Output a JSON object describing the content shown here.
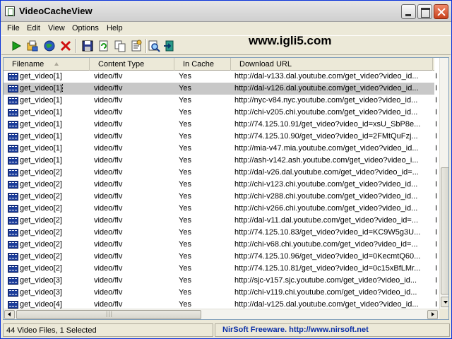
{
  "window": {
    "title": "VideoCacheView"
  },
  "menu": [
    "File",
    "Edit",
    "View",
    "Options",
    "Help"
  ],
  "watermark": "www.igli5.com",
  "toolbar": {
    "icons": [
      "play-icon",
      "export-icon",
      "globe-icon",
      "delete-icon",
      "save-icon",
      "refresh-icon",
      "copy-icon",
      "properties-icon",
      "find-icon",
      "exit-icon"
    ]
  },
  "columns": [
    "Filename",
    "Content Type",
    "In Cache",
    "Download URL"
  ],
  "rows": [
    {
      "file": "get_video[1]",
      "type": "video/flv",
      "cache": "Yes",
      "url": "http://dal-v133.dal.youtube.com/get_video?video_id...",
      "extra": "I",
      "selected": false
    },
    {
      "file": "get_video[1]",
      "type": "video/flv",
      "cache": "Yes",
      "url": "http://dal-v126.dal.youtube.com/get_video?video_id...",
      "extra": "I",
      "selected": true
    },
    {
      "file": "get_video[1]",
      "type": "video/flv",
      "cache": "Yes",
      "url": "http://nyc-v84.nyc.youtube.com/get_video?video_id...",
      "extra": "I",
      "selected": false
    },
    {
      "file": "get_video[1]",
      "type": "video/flv",
      "cache": "Yes",
      "url": "http://chi-v205.chi.youtube.com/get_video?video_id...",
      "extra": "I",
      "selected": false
    },
    {
      "file": "get_video[1]",
      "type": "video/flv",
      "cache": "Yes",
      "url": "http://74.125.10.91/get_video?video_id=xsU_SbP8e...",
      "extra": "I",
      "selected": false
    },
    {
      "file": "get_video[1]",
      "type": "video/flv",
      "cache": "Yes",
      "url": "http://74.125.10.90/get_video?video_id=2FMtQuFzj...",
      "extra": "I",
      "selected": false
    },
    {
      "file": "get_video[1]",
      "type": "video/flv",
      "cache": "Yes",
      "url": "http://mia-v47.mia.youtube.com/get_video?video_id...",
      "extra": "I",
      "selected": false
    },
    {
      "file": "get_video[1]",
      "type": "video/flv",
      "cache": "Yes",
      "url": "http://ash-v142.ash.youtube.com/get_video?video_i...",
      "extra": "I",
      "selected": false
    },
    {
      "file": "get_video[2]",
      "type": "video/flv",
      "cache": "Yes",
      "url": "http://dal-v26.dal.youtube.com/get_video?video_id=...",
      "extra": "I",
      "selected": false
    },
    {
      "file": "get_video[2]",
      "type": "video/flv",
      "cache": "Yes",
      "url": "http://chi-v123.chi.youtube.com/get_video?video_id...",
      "extra": "I",
      "selected": false
    },
    {
      "file": "get_video[2]",
      "type": "video/flv",
      "cache": "Yes",
      "url": "http://chi-v288.chi.youtube.com/get_video?video_id...",
      "extra": "I",
      "selected": false
    },
    {
      "file": "get_video[2]",
      "type": "video/flv",
      "cache": "Yes",
      "url": "http://chi-v266.chi.youtube.com/get_video?video_id...",
      "extra": "I",
      "selected": false
    },
    {
      "file": "get_video[2]",
      "type": "video/flv",
      "cache": "Yes",
      "url": "http://dal-v11.dal.youtube.com/get_video?video_id=...",
      "extra": "I",
      "selected": false
    },
    {
      "file": "get_video[2]",
      "type": "video/flv",
      "cache": "Yes",
      "url": "http://74.125.10.83/get_video?video_id=KC9W5g3U...",
      "extra": "I",
      "selected": false
    },
    {
      "file": "get_video[2]",
      "type": "video/flv",
      "cache": "Yes",
      "url": "http://chi-v68.chi.youtube.com/get_video?video_id=...",
      "extra": "I",
      "selected": false
    },
    {
      "file": "get_video[2]",
      "type": "video/flv",
      "cache": "Yes",
      "url": "http://74.125.10.96/get_video?video_id=0KecmtQ60...",
      "extra": "I",
      "selected": false
    },
    {
      "file": "get_video[2]",
      "type": "video/flv",
      "cache": "Yes",
      "url": "http://74.125.10.81/get_video?video_id=0c15xBfLMr...",
      "extra": "I",
      "selected": false
    },
    {
      "file": "get_video[3]",
      "type": "video/flv",
      "cache": "Yes",
      "url": "http://sjc-v157.sjc.youtube.com/get_video?video_id...",
      "extra": "I",
      "selected": false
    },
    {
      "file": "get_video[3]",
      "type": "video/flv",
      "cache": "Yes",
      "url": "http://chi-v119.chi.youtube.com/get_video?video_id...",
      "extra": "I",
      "selected": false
    },
    {
      "file": "get_video[4]",
      "type": "video/flv",
      "cache": "Yes",
      "url": "http://dal-v125.dal.youtube.com/get_video?video_id...",
      "extra": "I",
      "selected": false
    }
  ],
  "status": {
    "left": "44 Video Files, 1 Selected",
    "right": "NirSoft Freeware.  http://www.nirsoft.net"
  }
}
